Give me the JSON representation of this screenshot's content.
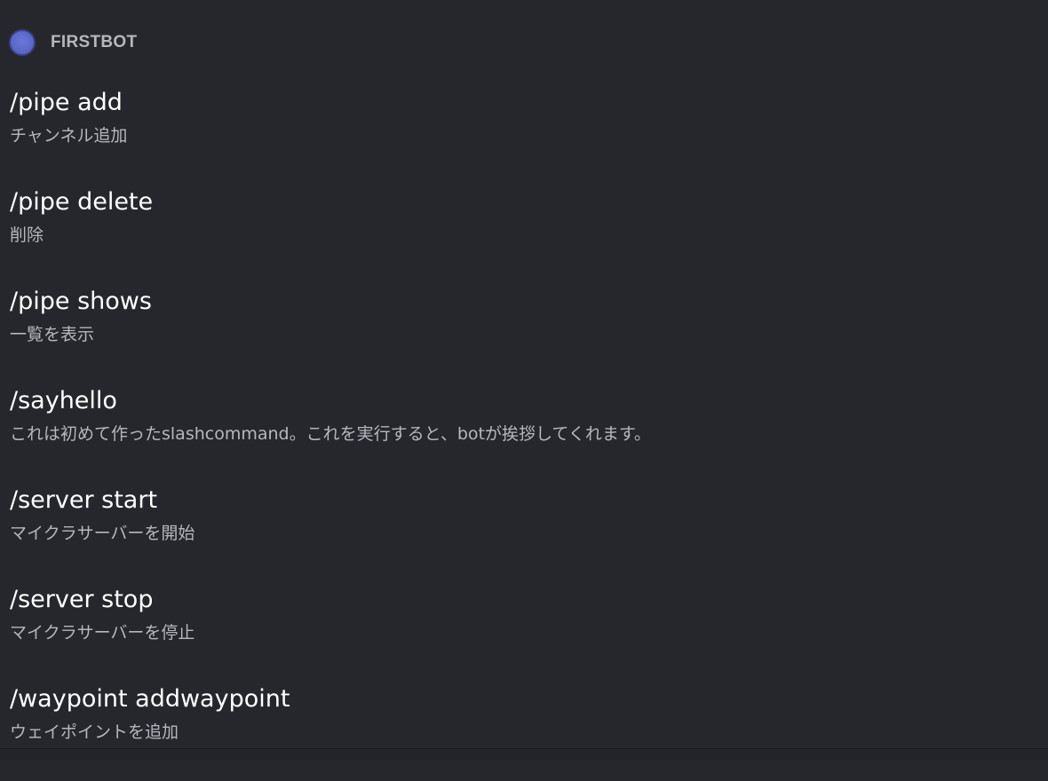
{
  "bot": {
    "name": "FIRSTBOT",
    "avatar_color": "#5865c8"
  },
  "commands": [
    {
      "name": "/pipe add",
      "description": "チャンネル追加"
    },
    {
      "name": "/pipe delete",
      "description": "削除"
    },
    {
      "name": "/pipe shows",
      "description": "一覧を表示"
    },
    {
      "name": "/sayhello",
      "description": "これは初めて作ったslashcommand。これを実行すると、botが挨拶してくれます。"
    },
    {
      "name": "/server start",
      "description": "マイクラサーバーを開始"
    },
    {
      "name": "/server stop",
      "description": "マイクラサーバーを停止"
    },
    {
      "name": "/waypoint addwaypoint",
      "description": "ウェイポイントを追加"
    }
  ]
}
